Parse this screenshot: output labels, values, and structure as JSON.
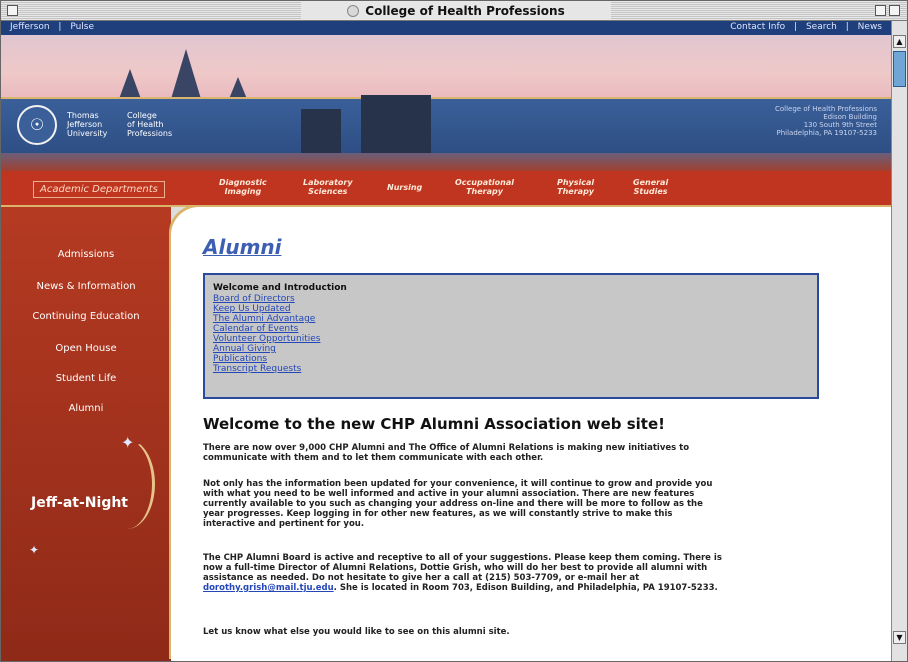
{
  "window": {
    "title": "College of Health Professions"
  },
  "topnav": {
    "left": [
      "Jefferson",
      "Pulse"
    ],
    "right": [
      "Contact Info",
      "Search",
      "News"
    ],
    "separator": "|"
  },
  "header": {
    "logo_glyph": "☉",
    "university": [
      "Thomas",
      "Jefferson",
      "University"
    ],
    "college": [
      "College",
      "of Health",
      "Professions"
    ],
    "address": [
      "College of Health Professions",
      "Edison Building",
      "130 South 9th Street",
      "Philadelphia, PA 19107-5233"
    ]
  },
  "departments": {
    "label": "Academic Departments",
    "items": [
      [
        "Diagnostic",
        "Imaging"
      ],
      [
        "Laboratory",
        "Sciences"
      ],
      [
        "Nursing",
        ""
      ],
      [
        "Occupational",
        "Therapy"
      ],
      [
        "Physical",
        "Therapy"
      ],
      [
        "General",
        "Studies"
      ]
    ]
  },
  "sidebar": {
    "items": [
      "Admissions",
      "News & Information",
      "Continuing Education",
      "Open House",
      "Student Life",
      "Alumni"
    ],
    "promo": "Jeff-at-Night"
  },
  "main": {
    "title": "Alumni",
    "toc": {
      "heading": "Welcome and Introduction",
      "links": [
        "Board of Directors",
        "Keep Us Updated",
        "The Alumni Advantage",
        "Calendar of Events",
        "Volunteer Opportunities",
        "Annual Giving",
        "Publications",
        "Transcript Requests"
      ]
    },
    "welcome_heading": "Welcome to the new CHP Alumni Association web site!",
    "para1": "There are now over 9,000 CHP Alumni and The Office of Alumni Relations is making new initiatives to communicate with them and to let them communicate with each other.",
    "para2": "Not only has the information been updated for your convenience, it will continue to grow and provide you with what you need to be well informed and active in your alumni association. There are new features currently available to you such as changing your address on-line and there will be more to follow as the year progresses. Keep logging in for other new features, as we will constantly strive to make this interactive and pertinent for you.",
    "para3_a": "The CHP Alumni Board is active and receptive to all of your suggestions. Please keep them coming. There is now a full-time Director of Alumni Relations, Dottie Grish, who will do her best to provide all alumni with assistance as needed. Do not hesitate to give her a call at (215) 503-7709, or e-mail her at",
    "email": "dorothy.grish@mail.tju.edu",
    "para3_b": ". She is located in Room 703, Edison Building, and Philadelphia, PA 19107-5233.",
    "para4": "Let us know what else you would like to see on this alumni site."
  },
  "colors": {
    "accent_blue": "#2a4aa0",
    "brand_red": "#c0351f",
    "gold": "#d9b46a"
  }
}
